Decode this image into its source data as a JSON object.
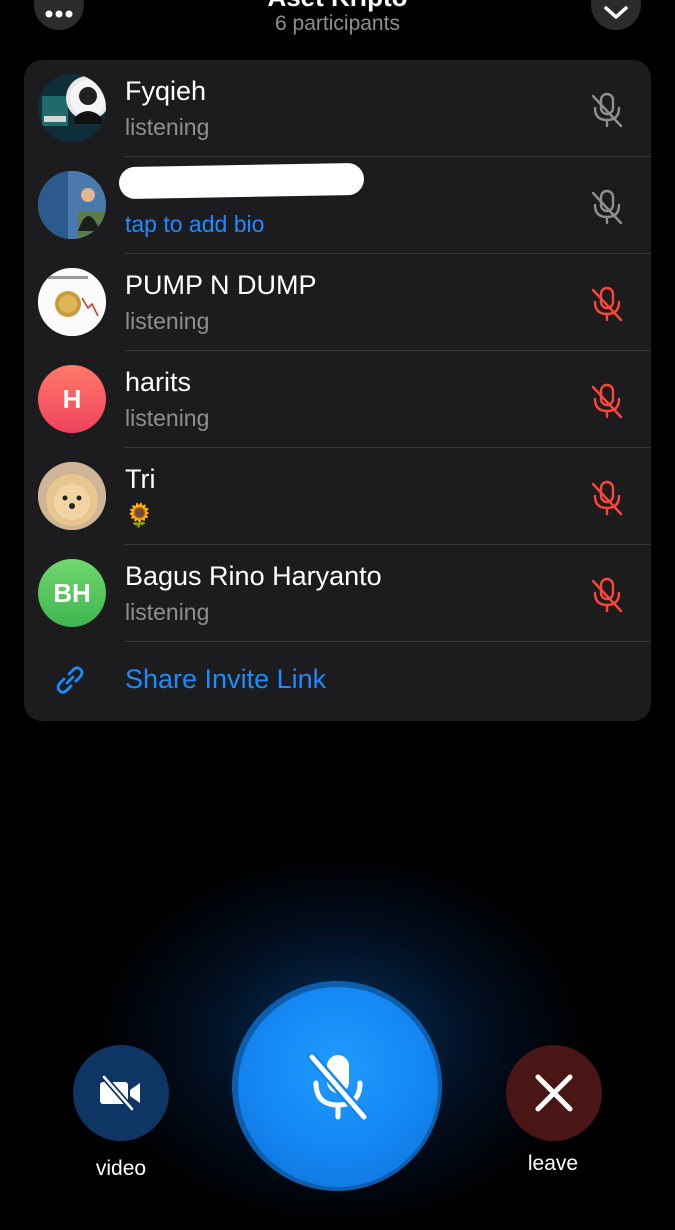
{
  "header": {
    "title": "Aset Kripto",
    "participants_count": "6 participants"
  },
  "participants": [
    {
      "name": "Fyqieh",
      "status": "listening",
      "mic_state": "muted"
    },
    {
      "name": "",
      "status": "tap to add bio",
      "mic_state": "muted"
    },
    {
      "name": "PUMP N DUMP",
      "status": "listening",
      "mic_state": "muted-by-admin"
    },
    {
      "name": "harits",
      "initials": "H",
      "status": "listening",
      "mic_state": "muted-by-admin"
    },
    {
      "name": "Tri",
      "status": "🌻",
      "mic_state": "muted-by-admin"
    },
    {
      "name": "Bagus Rino Haryanto",
      "initials": "BH",
      "status": "listening",
      "mic_state": "muted-by-admin"
    }
  ],
  "share": {
    "label": "Share Invite Link"
  },
  "controls": {
    "video_label": "video",
    "leave_label": "leave"
  },
  "colors": {
    "accent": "#1a8cff",
    "muted_mic": "#8e8e93",
    "admin_muted_mic": "#ff453a",
    "panel_bg": "#1c1c1e"
  }
}
